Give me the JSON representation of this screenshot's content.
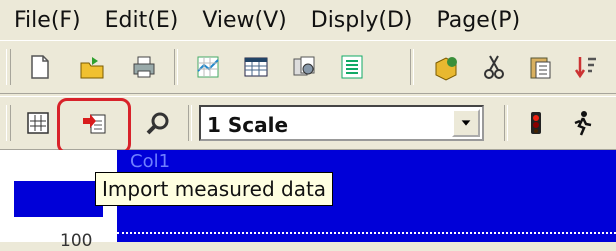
{
  "menu": [
    "File(F)",
    "Edit(E)",
    "View(V)",
    "Disply(D)",
    "Page(P)"
  ],
  "toolbar2": {
    "scale_value": "1 Scale"
  },
  "canvas_label": "Col1",
  "axis_number": "100",
  "tooltip": "Import measured data"
}
